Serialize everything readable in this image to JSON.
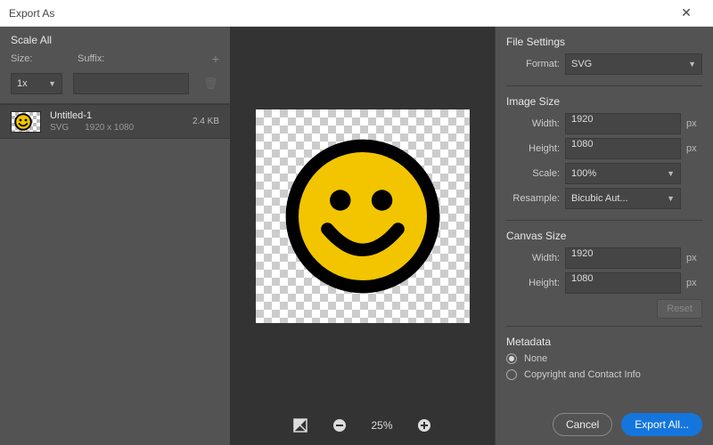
{
  "window": {
    "title": "Export As"
  },
  "scale_all": {
    "header": "Scale All",
    "size_label": "Size:",
    "suffix_label": "Suffix:",
    "size_value": "1x",
    "suffix_value": ""
  },
  "asset": {
    "name": "Untitled-1",
    "format": "SVG",
    "dimensions": "1920 x 1080",
    "filesize": "2.4 KB"
  },
  "zoom": {
    "level": "25%"
  },
  "file_settings": {
    "header": "File Settings",
    "format_label": "Format:",
    "format_value": "SVG"
  },
  "image_size": {
    "header": "Image Size",
    "width_label": "Width:",
    "width_value": "1920",
    "height_label": "Height:",
    "height_value": "1080",
    "px": "px",
    "scale_label": "Scale:",
    "scale_value": "100%",
    "resample_label": "Resample:",
    "resample_value": "Bicubic Aut..."
  },
  "canvas_size": {
    "header": "Canvas Size",
    "width_label": "Width:",
    "width_value": "1920",
    "height_label": "Height:",
    "height_value": "1080",
    "px": "px",
    "reset": "Reset"
  },
  "metadata": {
    "header": "Metadata",
    "none": "None",
    "copyright": "Copyright and Contact Info"
  },
  "footer": {
    "cancel": "Cancel",
    "export": "Export All..."
  }
}
